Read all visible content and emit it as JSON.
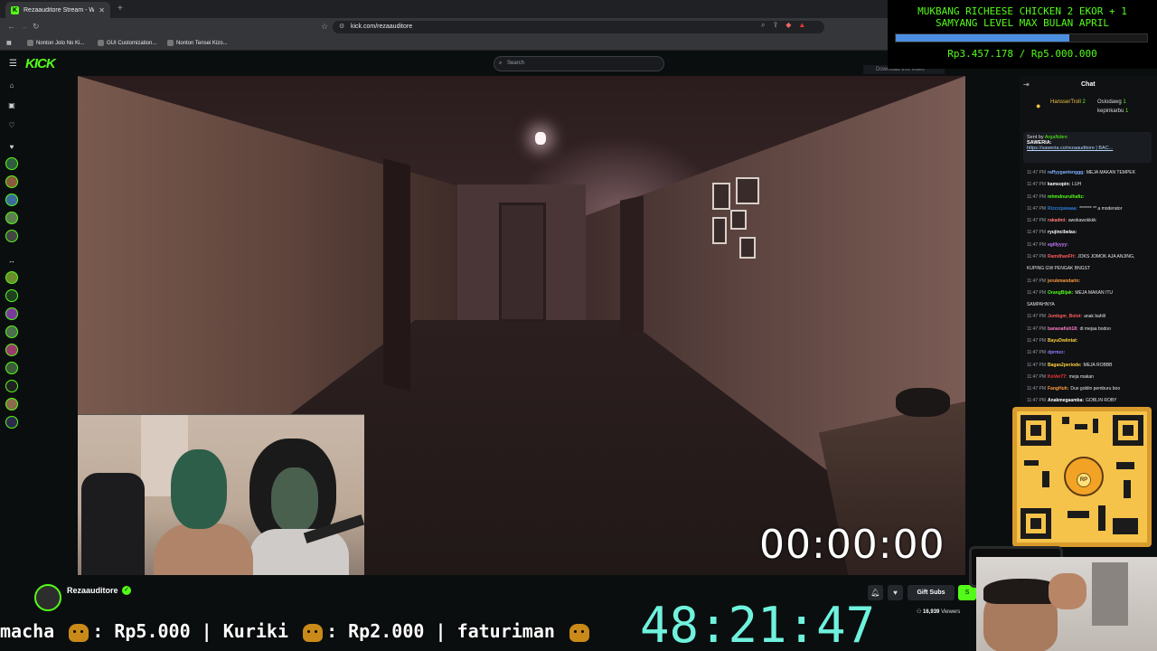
{
  "browser": {
    "tab_title": "Rezaauditore Stream - Watch",
    "url": "kick.com/rezaauditore",
    "bookmarks": [
      "Nonton Jolo No Ki...",
      "GUI Customization...",
      "Nonton Tensei Kizo..."
    ]
  },
  "kick": {
    "search_placeholder": "Search"
  },
  "goal": {
    "title": "MUKBANG RICHEESE CHICKEN 2 EKOR + 1\nSAMYANG LEVEL MAX BULAN APRIL",
    "progress_fraction": 0.69,
    "amount": "Rp3.457.178 / Rp5.000.000",
    "bar_color": "#4c8fe0"
  },
  "video": {
    "timer": "00:00:00",
    "download_hint": "Download this video"
  },
  "streamer": {
    "name": "Rezaauditore",
    "gift_subs_label": "Gift Subs",
    "viewers_count": "16,939",
    "viewers_label": "Viewers"
  },
  "ticker": {
    "items": [
      {
        "text": "macha",
        "amount": ": Rp5.000 |"
      },
      {
        "text": "Kuriki",
        "amount": ": Rp2.000 |"
      },
      {
        "text": "faturiman",
        "amount": ""
      }
    ]
  },
  "stream_timer": "48:21:47",
  "chat": {
    "title": "Chat",
    "leaderboard": [
      {
        "name": "HansserTroll",
        "count": "2"
      },
      {
        "name": "Oslodawg",
        "count": "1"
      },
      {
        "name": "kepinkarbu",
        "count": "1"
      }
    ],
    "pinned": {
      "sent_by_label": "Sent by",
      "sent_by": "ArgaNden",
      "label": "SAWERIA:",
      "url": "https://saweria.co/rezaauditore | BAC..."
    },
    "messages": [
      {
        "time": "11:47 PM",
        "user": "raffyygantenggg:",
        "text": "MEJA MAKAN TEMPEK",
        "color": "#7fb3ff"
      },
      {
        "time": "11:47 PM",
        "user": "kamsopin:",
        "text": "LUH",
        "color": "#ffffff"
      },
      {
        "time": "11:47 PM",
        "user": "mhmdnurulhafiz:",
        "text": "",
        "color": "#53fc18"
      },
      {
        "time": "11:47 PM",
        "user": "Rizzzzjawaaa:",
        "text": "******* ** a moderator",
        "color": "#2d7bd8"
      },
      {
        "time": "11:47 PM",
        "user": "rakadmi:",
        "text": "awokawokkkk",
        "color": "#ff7a7a"
      },
      {
        "time": "11:47 PM",
        "user": "ryujincibelas:",
        "text": "",
        "color": "#ffffff"
      },
      {
        "time": "11:47 PM",
        "user": "egillyyyy:",
        "text": "",
        "color": "#c57bff"
      },
      {
        "time": "11:47 PM",
        "user": "RamdhanFH:",
        "text": "JOKS JOMOK AJA ANJING,",
        "color": "#ff5a5a"
      },
      {
        "time": "",
        "user": "",
        "text": "KUPING GW PENGAK BNGST",
        "color": "#ffffff"
      },
      {
        "time": "11:47 PM",
        "user": "jerukmandarin:",
        "text": "",
        "color": "#ff9a3c"
      },
      {
        "time": "11:47 PM",
        "user": "OrangBijak:",
        "text": "MEJA MAKAN ITU",
        "color": "#53fc18"
      },
      {
        "time": "",
        "user": "",
        "text": "SAMPAHNYA",
        "color": "#ffffff"
      },
      {
        "time": "11:47 PM",
        "user": "Jumbgm_Bolot:",
        "text": "anak bahlil",
        "color": "#ff5a5a"
      },
      {
        "time": "11:47 PM",
        "user": "bananafish18:",
        "text": "di mejaa bodoo",
        "color": "#ff7ac8"
      },
      {
        "time": "11:47 PM",
        "user": "BayuDwiintat:",
        "text": "",
        "color": "#ffd23c"
      },
      {
        "time": "11:47 PM",
        "user": "dprmzz:",
        "text": "",
        "color": "#9b7bff"
      },
      {
        "time": "11:47 PM",
        "user": "Bagas2periode:",
        "text": "MEJA ROBBB",
        "color": "#ffd23c"
      },
      {
        "time": "11:47 PM",
        "user": "KoVer77:",
        "text": "meja makan",
        "color": "#ff3a3a"
      },
      {
        "time": "11:47 PM",
        "user": "FangHuh:",
        "text": "Duo goblin pemburu boo",
        "color": "#ff9a3c"
      },
      {
        "time": "11:47 PM",
        "user": "Anakmegaamba:",
        "text": "GOBLIN ROBY",
        "color": "#ffffff"
      },
      {
        "time": "11:47 PM",
        "user": "Natsuu_naru:",
        "text": "",
        "color": "#ff7a7a"
      }
    ]
  },
  "qr": {
    "coin_label": "RP"
  },
  "kick_badge": {
    "count": "10"
  }
}
